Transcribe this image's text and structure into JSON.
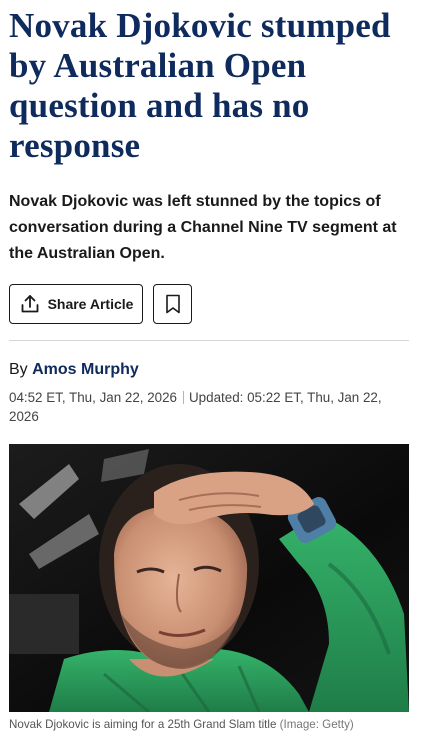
{
  "article": {
    "headline": "Novak Djokovic stumped by Australian Open question and has no response",
    "standfirst": "Novak Djokovic was left stunned by the topics of conversation during a Channel Nine TV segment at the Australian Open.",
    "actions": {
      "share_label": "Share Article",
      "share_icon": "share-icon",
      "bookmark_icon": "bookmark-icon"
    },
    "byline": {
      "prefix": "By",
      "author": "Amos Murphy"
    },
    "dates": {
      "published": "04:52 ET, Thu, Jan 22, 2026",
      "updated": "Updated: 05:22 ET, Thu, Jan 22, 2026"
    },
    "image": {
      "caption": "Novak Djokovic is aiming for a 25th Grand Slam title",
      "credit": "(Image: Getty)"
    }
  },
  "colors": {
    "headline": "#0f2a5c",
    "author": "#0f2a5c",
    "text": "#1a1a1a"
  }
}
